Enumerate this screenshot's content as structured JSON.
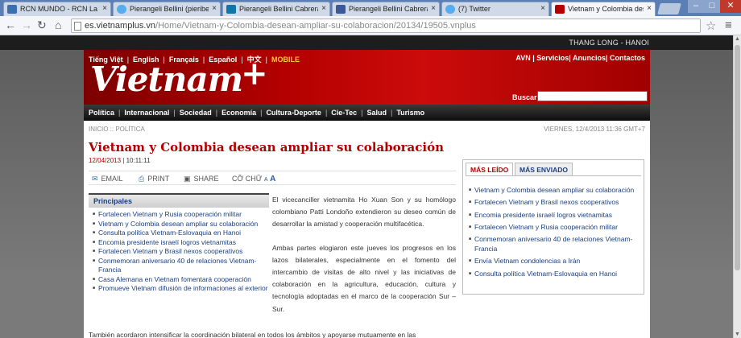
{
  "browser": {
    "tabs": [
      {
        "label": "RCN MUNDO - RCN La Radi",
        "fav_color": "#3a6fb0"
      },
      {
        "label": "Pierangeli Bellini (pieribellini)",
        "fav_color": "#55acee"
      },
      {
        "label": "Pierangeli Bellini Cabrera | L",
        "fav_color": "#0e76a8"
      },
      {
        "label": "Pierangeli Bellini Cabrera",
        "fav_color": "#3b5998"
      },
      {
        "label": "(7) Twitter",
        "fav_color": "#55acee"
      },
      {
        "label": "Vietnam y Colombia desean",
        "fav_color": "#b30000"
      }
    ],
    "tab_close": "×",
    "url_host": "es.vietnamplus.vn",
    "url_path": "/Home/Vietnam-y-Colombia-desean-ampliar-su-colaboracion/20134/19505.vnplus",
    "window_controls": {
      "minimize": "–",
      "maximize": "□",
      "close": "✕"
    }
  },
  "site": {
    "city_label": "THANG LONG - HANOI",
    "languages": [
      "Tiếng Việt",
      "English",
      "Français",
      "Español",
      "中文"
    ],
    "mobile_label": "MOBILE",
    "top_links": "AVN | Servicios| Anuncios| Contactos",
    "logo_text": "Vietnam",
    "logo_plus": "+",
    "search_label": "Buscar",
    "nav": [
      "Política",
      "Internacional",
      "Sociedad",
      "Economía",
      "Cultura-Deporte",
      "Cie-Tec",
      "Salud",
      "Turismo"
    ],
    "breadcrumb": "INICIO :: POLÍTICA",
    "dateline": "VIERNES, 12/4/2013 11:36 GMT+7"
  },
  "article": {
    "headline": "Vietnam y Colombia desean ampliar su colaboración",
    "date": "12/04/2013",
    "time": "| 10:11:11",
    "tools": {
      "email": "EMAIL",
      "print": "PRINT",
      "share": "SHARE",
      "font_size": "CỠ CHỮ",
      "font_small": "A",
      "font_large": "A"
    },
    "paragraphs": [
      "El vicecanciller vietnamita Ho Xuan Son y su homólogo colombiano Patti Londoño extendieron su deseo común de desarrollar la amistad y cooperación multifacética.",
      "Ambas partes elogiaron este jueves los progresos en los lazos bilaterales, especialmente en el fomento del intercambio de visitas de alto nivel y las iniciativas de colaboración en la agricultura, educación, cultura y tecnología adoptadas en el marco de la cooperación Sur – Sur."
    ],
    "continuation": "También acordaron intensificar la coordinación bilateral en todos los ámbitos y apoyarse mutuamente en las"
  },
  "principales": {
    "title": "Principales",
    "items": [
      "Fortalecen Vietnam y Rusia cooperación militar",
      "Vietnam y Colombia desean ampliar su colaboración",
      "Consulta política Vietnam-Eslovaquia en Hanoi",
      "Encomia presidente israelí logros vietnamitas",
      "Fortalecen Vietnam y Brasil nexos cooperativos",
      "Conmemoran aniversario 40 de relaciones Vietnam-Francia",
      "Casa Alemana en Vietnam fomentará cooperación",
      "Promueve Vietnam difusión de informaciones al exterior"
    ]
  },
  "most": {
    "tab_read": "MÁS LEÍDO",
    "tab_sent": "MÁS ENVIADO",
    "items": [
      "Vietnam y Colombia desean ampliar su colaboración",
      "Fortalecen Vietnam y Brasil nexos cooperativos",
      "Encomia presidente israelí logros vietnamitas",
      "Fortalecen Vietnam y Rusia cooperación militar",
      "Conmemoran aniversario 40 de relaciones Vietnam-Francia",
      "Envía Vietnam condolencias a Irán",
      "Consulta política Vietnam-Eslovaquia en Hanoi"
    ]
  },
  "colors": {
    "brand_red": "#b30000",
    "link_blue": "#1a3f80"
  }
}
